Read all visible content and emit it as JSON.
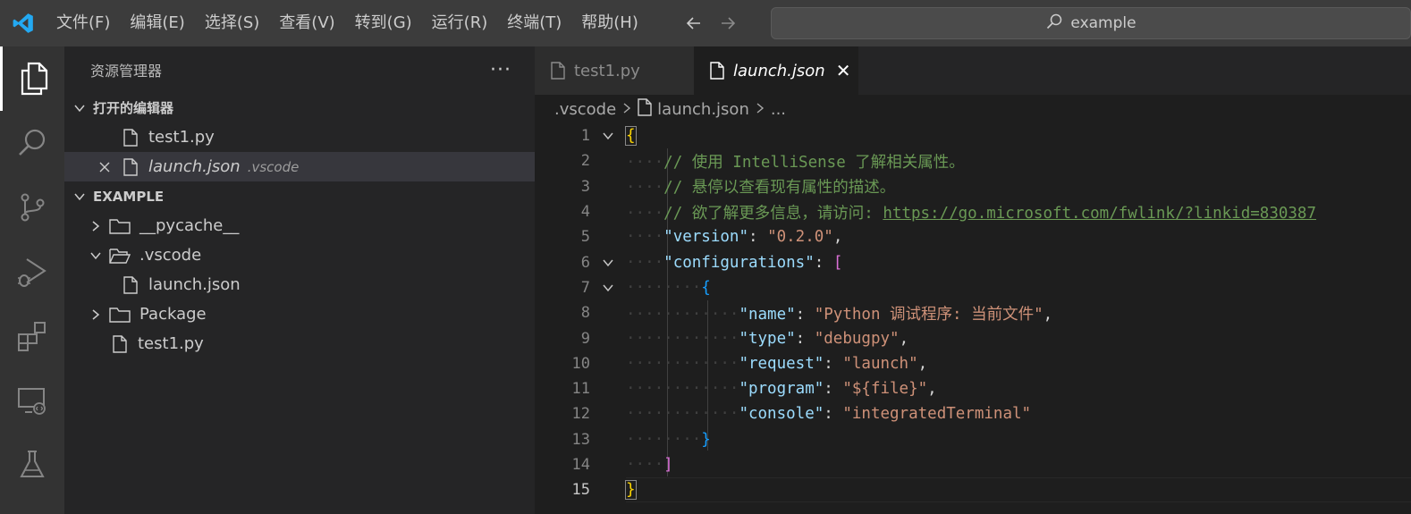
{
  "titlebar": {
    "menu": [
      "文件(F)",
      "编辑(E)",
      "选择(S)",
      "查看(V)",
      "转到(G)",
      "运行(R)",
      "终端(T)",
      "帮助(H)"
    ],
    "search_text": "example"
  },
  "sidebar": {
    "title": "资源管理器",
    "more": "···",
    "open_editors_label": "打开的编辑器",
    "open_editors": [
      {
        "name": "test1.py"
      },
      {
        "name": "launch.json",
        "desc": ".vscode"
      }
    ],
    "folder_label": "EXAMPLE",
    "tree": [
      {
        "name": "__pycache__",
        "type": "folder"
      },
      {
        "name": ".vscode",
        "type": "folder-open"
      },
      {
        "name": "launch.json",
        "type": "file"
      },
      {
        "name": "Package",
        "type": "folder"
      },
      {
        "name": "test1.py",
        "type": "file"
      }
    ]
  },
  "editor": {
    "tabs": [
      {
        "label": "test1.py"
      },
      {
        "label": "launch.json",
        "close": "✕"
      }
    ],
    "breadcrumb": [
      ".vscode",
      "launch.json",
      "..."
    ],
    "line_numbers": [
      "1",
      "2",
      "3",
      "4",
      "5",
      "6",
      "7",
      "8",
      "9",
      "10",
      "11",
      "12",
      "13",
      "14",
      "15"
    ],
    "code": {
      "l2": "// 使用 IntelliSense 了解相关属性。",
      "l3": "// 悬停以查看现有属性的描述。",
      "l4_pre": "// 欲了解更多信息，请访问: ",
      "l4_link": "https://go.microsoft.com/fwlink/?linkid=830387",
      "version_key": "\"version\"",
      "version_val": "\"0.2.0\"",
      "configs_key": "\"configurations\"",
      "name_key": "\"name\"",
      "name_val": "\"Python 调试程序: 当前文件\"",
      "type_key": "\"type\"",
      "type_val": "\"debugpy\"",
      "request_key": "\"request\"",
      "request_val": "\"launch\"",
      "program_key": "\"program\"",
      "program_val": "\"${file}\"",
      "console_key": "\"console\"",
      "console_val": "\"integratedTerminal\""
    }
  },
  "colors": {
    "accent": "#007acc",
    "keyword": "#9cdcfe",
    "string": "#ce9178",
    "comment": "#6a9955"
  },
  "icons": [
    "vscode-logo-icon",
    "arrow-left-icon",
    "arrow-right-icon",
    "search-icon",
    "files-icon",
    "search-view-icon",
    "source-control-icon",
    "run-debug-icon",
    "extensions-icon",
    "remote-explorer-icon",
    "testing-icon",
    "file-icon",
    "folder-icon",
    "chevron-icon",
    "close-icon"
  ]
}
